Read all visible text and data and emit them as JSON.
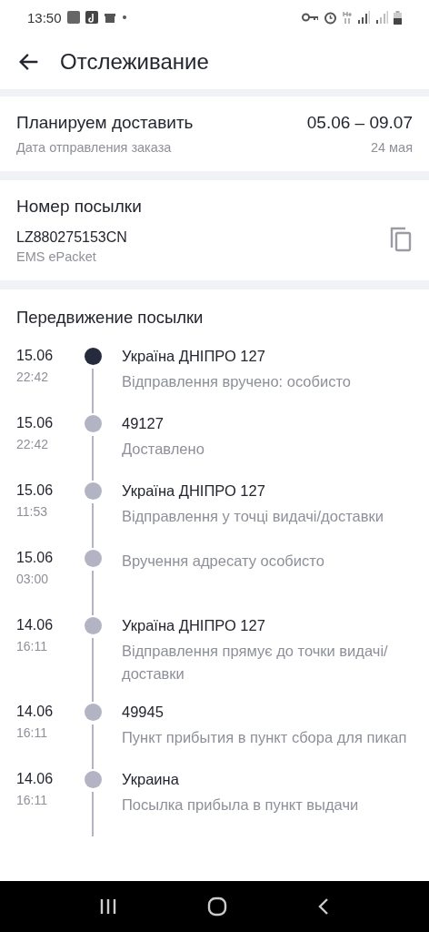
{
  "status_bar": {
    "time": "13:50"
  },
  "header": {
    "title": "Отслеживание"
  },
  "delivery": {
    "title": "Планируем доставить",
    "range": "05.06 – 09.07",
    "subtitle": "Дата отправления заказа",
    "date": "24 мая"
  },
  "parcel": {
    "title": "Номер посылки",
    "number": "LZ880275153CN",
    "service": "EMS ePacket"
  },
  "movement": {
    "title": "Передвижение посылки",
    "events": [
      {
        "date": "15.06",
        "time": "22:42",
        "place": "Україна ДНІПРО 127",
        "description": "Відправлення вручено: особисто",
        "active": true
      },
      {
        "date": "15.06",
        "time": "22:42",
        "place": "49127",
        "description": "Доставлено",
        "active": false
      },
      {
        "date": "15.06",
        "time": "11:53",
        "place": "Україна ДНІПРО 127",
        "description": "Відправлення у точці видачі/доставки",
        "active": false
      },
      {
        "date": "15.06",
        "time": "03:00",
        "description": "Вручення адресату особисто",
        "active": false
      },
      {
        "date": "14.06",
        "time": "16:11",
        "place": "Україна ДНІПРО 127",
        "description": "Відправлення прямує до точки видачі/ доставки",
        "active": false
      },
      {
        "date": "14.06",
        "time": "16:11",
        "place": "49945",
        "description": "Пункт прибытия в пункт сбора для пикап",
        "active": false
      },
      {
        "date": "14.06",
        "time": "16:11",
        "place": "Украина",
        "description": "Посылка прибыла в пункт выдачи",
        "active": false
      }
    ]
  }
}
